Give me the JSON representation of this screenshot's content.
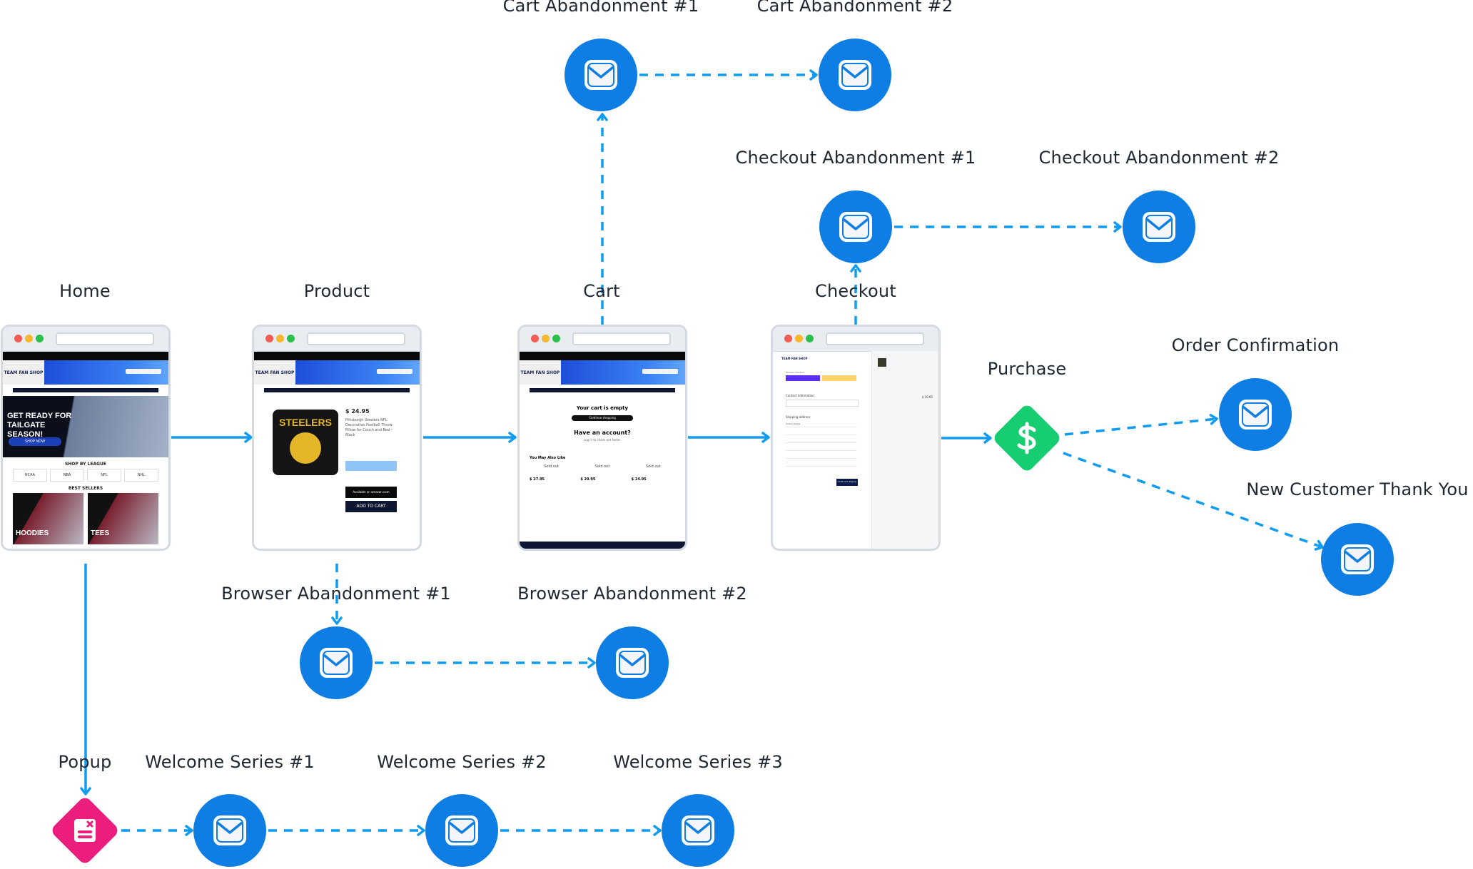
{
  "diagram": {
    "colors": {
      "connector": "#0f9cf0",
      "email_node": "#0e7ee4",
      "purchase_node": "#17cd72",
      "popup_node": "#ec1e7d",
      "label_text": "#1f2733"
    },
    "page_labels": {
      "home": "Home",
      "product": "Product",
      "cart": "Cart",
      "checkout": "Checkout",
      "purchase": "Purchase",
      "popup": "Popup"
    },
    "email_labels": {
      "cart_ab_1": "Cart Abandonment #1",
      "cart_ab_2": "Cart Abandonment #2",
      "checkout_ab_1": "Checkout Abandonment #1",
      "checkout_ab_2": "Checkout Abandonment #2",
      "order_confirmation": "Order Confirmation",
      "new_customer": "New Customer Thank You",
      "browser_ab_1": "Browser Abandonment #1",
      "browser_ab_2": "Browser Abandonment #2",
      "welcome_1": "Welcome Series #1",
      "welcome_2": "Welcome Series #2",
      "welcome_3": "Welcome Series #3"
    },
    "icons": {
      "email": "envelope-icon",
      "purchase": "dollar-icon",
      "popup": "popup-form-icon"
    }
  },
  "screens": {
    "brand": "TEAM FAN SHOP",
    "home": {
      "hero_title": "GET READY FOR TAILGATE SEASON!",
      "hero_button": "SHOP NOW",
      "shop_by_league": "SHOP BY LEAGUE",
      "leagues": [
        "NCAA",
        "NBA",
        "NFL",
        "NHL"
      ],
      "best_sellers": "BEST SELLERS",
      "categories": [
        "HOODIES",
        "TEES"
      ]
    },
    "product": {
      "price": "$ 24.95",
      "title": "Pittsburgh Steelers NFL Decorative Football Throw Pillow for Couch and Bed - Black",
      "pillow_text": "STEELERS",
      "amazon_button": "Available on amazon.com",
      "add_to_cart": "ADD TO CART"
    },
    "cart": {
      "empty_title": "Your cart is empty",
      "continue_button": "Continue shopping",
      "account_title": "Have an account?",
      "account_sub": "Log in to check out faster.",
      "also_like": "You May Also Like",
      "sold_out": "Sold out",
      "prices": [
        "$ 27.95",
        "$ 29.95",
        "$ 24.95"
      ]
    },
    "checkout": {
      "express": "Express checkout",
      "contact": "Contact information",
      "shipping": "Shipping address",
      "country": "United States",
      "continue_button": "Continue to shipping",
      "total": "$ 30.95"
    }
  }
}
